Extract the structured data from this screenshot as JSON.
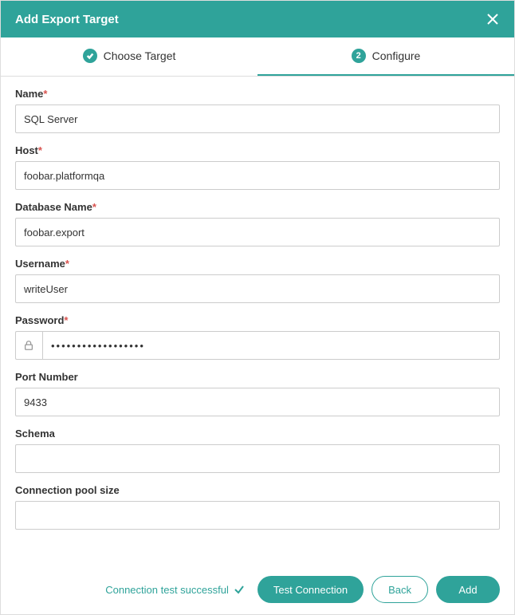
{
  "header": {
    "title": "Add Export Target"
  },
  "tabs": {
    "choose": {
      "label": "Choose Target",
      "completed": true
    },
    "configure": {
      "label": "Configure",
      "stepNumber": "2",
      "active": true
    }
  },
  "form": {
    "name": {
      "label": "Name",
      "required": "*",
      "value": "SQL Server"
    },
    "host": {
      "label": "Host",
      "required": "*",
      "value": "foobar.platformqa"
    },
    "database": {
      "label": "Database Name",
      "required": "*",
      "value": "foobar.export"
    },
    "username": {
      "label": "Username",
      "required": "*",
      "value": "writeUser"
    },
    "password": {
      "label": "Password",
      "required": "*",
      "value": "••••••••••••••••••"
    },
    "port": {
      "label": "Port Number",
      "value": "9433"
    },
    "schema": {
      "label": "Schema",
      "value": ""
    },
    "poolSize": {
      "label": "Connection pool size",
      "value": ""
    }
  },
  "footer": {
    "statusMessage": "Connection test successful",
    "testConnection": "Test Connection",
    "back": "Back",
    "add": "Add"
  }
}
